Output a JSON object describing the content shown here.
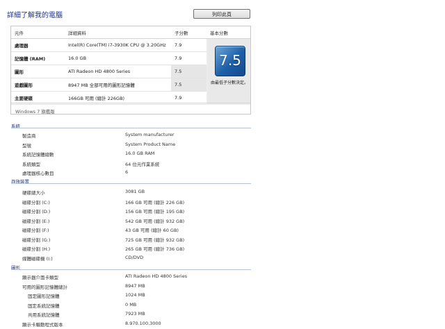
{
  "header": {
    "title": "詳細了解我的電腦",
    "print_label": "列印此頁"
  },
  "score_table": {
    "columns": [
      "元件",
      "詳細資料",
      "子分數",
      "基本分數"
    ],
    "rows": [
      {
        "component": "處理器",
        "detail": "Intel(R) Core(TM) i7-3930K CPU @ 3.20GHz",
        "subscore": "7.9"
      },
      {
        "component": "記憶體 (RAM)",
        "detail": "16.0 GB",
        "subscore": "7.9"
      },
      {
        "component": "圖形",
        "detail": "ATI Radeon HD 4800 Series",
        "subscore": "7.5"
      },
      {
        "component": "遊戲圖形",
        "detail": "8947 MB 全部可用的圖形記憶體",
        "subscore": "7.5"
      },
      {
        "component": "主要硬碟",
        "detail": "166GB 可用 (總計 226GB)",
        "subscore": "7.9"
      }
    ],
    "base_score": "7.5",
    "base_caption": "由最低子分數決定。",
    "edition": "Windows 7 旗艦版"
  },
  "sections": [
    {
      "title": "系統",
      "items": [
        {
          "key": "製造商",
          "value": "System manufacturer"
        },
        {
          "key": "型號",
          "value": "System Product Name"
        },
        {
          "key": "系統記憶體總數",
          "value": "16.0 GB RAM"
        },
        {
          "key": "系統類型",
          "value": "64 位元作業系統"
        },
        {
          "key": "處理器核心數目",
          "value": "6"
        }
      ]
    },
    {
      "title": "存放裝置",
      "items": [
        {
          "key": "硬碟總大小",
          "value": "3081 GB"
        },
        {
          "key": "磁碟分割 (C:)",
          "value": "166 GB 可用 (總計 226 GB)"
        },
        {
          "key": "磁碟分割 (D:)",
          "value": "156 GB 可用 (總計 195 GB)"
        },
        {
          "key": "磁碟分割 (E:)",
          "value": "542 GB 可用 (總計 932 GB)"
        },
        {
          "key": "磁碟分割 (F:)",
          "value": "43 GB 可用 (總計 60 GB)"
        },
        {
          "key": "磁碟分割 (G:)",
          "value": "725 GB 可用 (總計 932 GB)"
        },
        {
          "key": "磁碟分割 (H:)",
          "value": "265 GB 可用 (總計 736 GB)"
        },
        {
          "key": "媒體磁碟機 (I:)",
          "value": "CD/DVD"
        }
      ]
    },
    {
      "title": "圖形",
      "items": [
        {
          "key": "顯示器介面卡類型",
          "value": "ATI Radeon HD 4800 Series"
        },
        {
          "key": "可用的圖形記憶體總計",
          "value": "8947 MB"
        },
        {
          "key": "固定圖形記憶體",
          "value": "1024 MB"
        },
        {
          "key": "固定系統記憶體",
          "value": "0 MB"
        },
        {
          "key": "共用系統記憶體",
          "value": "7923 MB"
        },
        {
          "key": "顯示卡驅動程式版本",
          "value": "8.970.100.3000"
        }
      ]
    }
  ]
}
